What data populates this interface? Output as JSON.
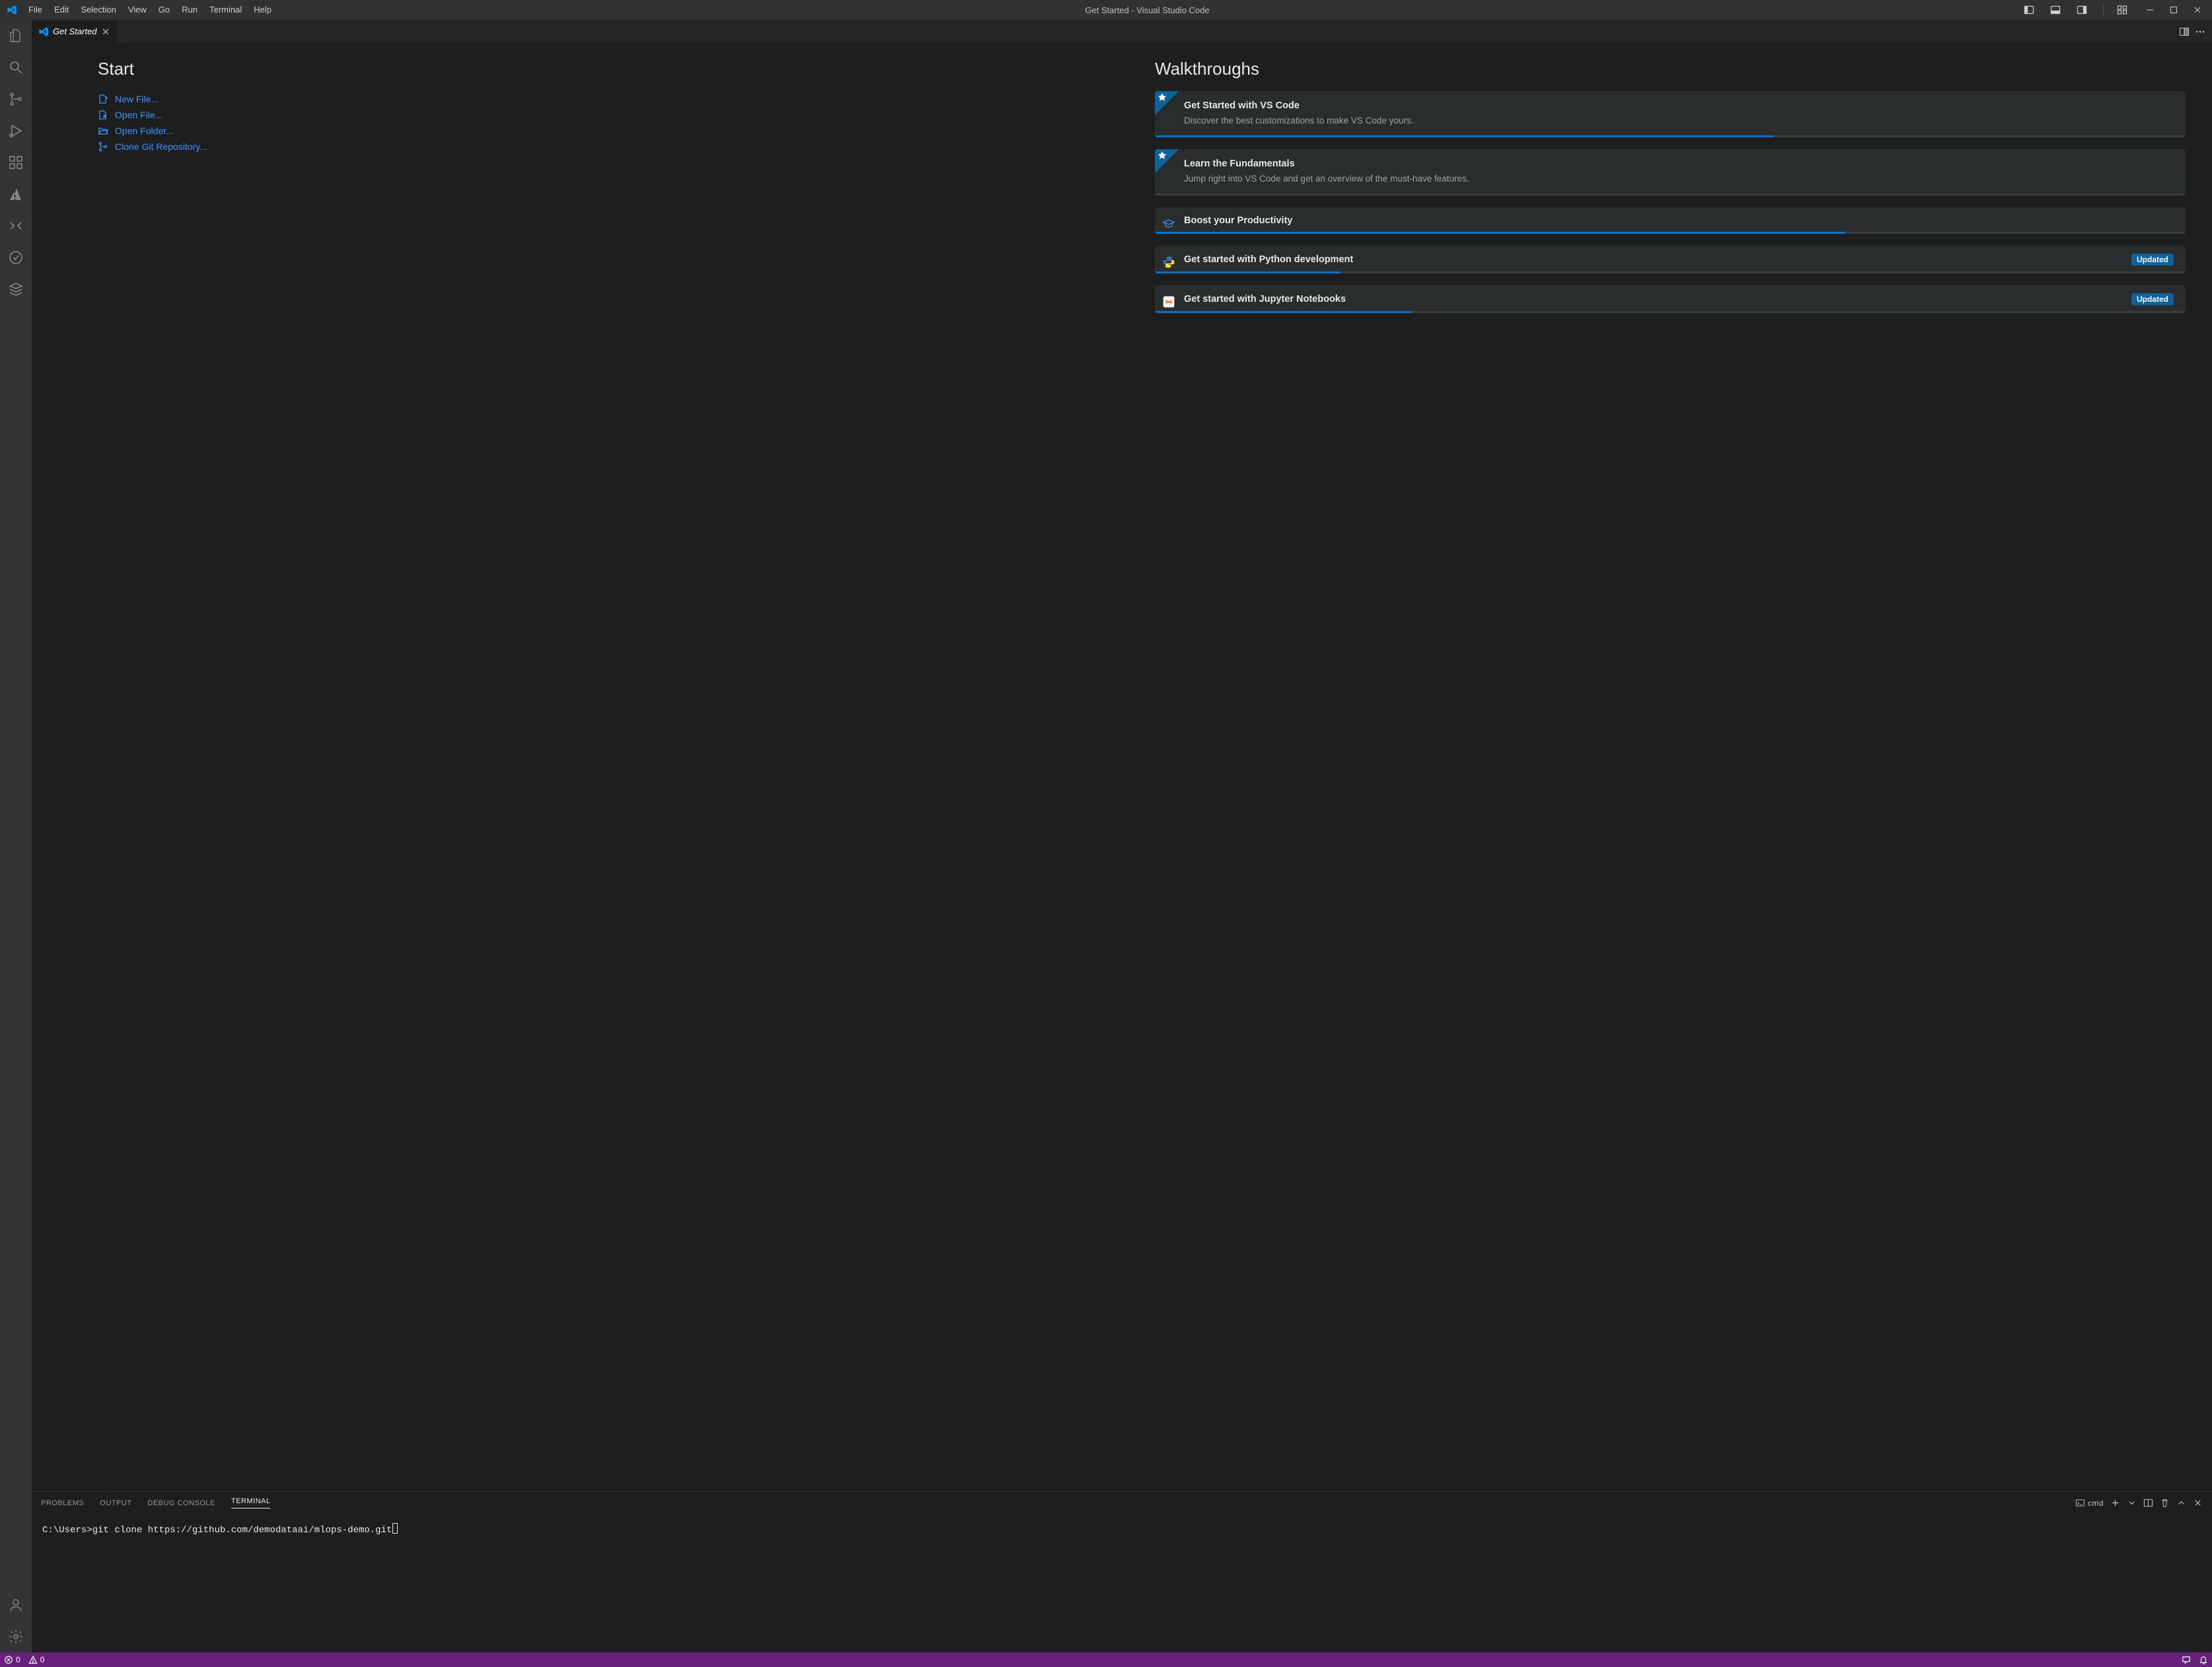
{
  "menubar": {
    "items": [
      "File",
      "Edit",
      "Selection",
      "View",
      "Go",
      "Run",
      "Terminal",
      "Help"
    ]
  },
  "titlebar": {
    "title": "Get Started - Visual Studio Code"
  },
  "tab": {
    "label": "Get Started"
  },
  "getStarted": {
    "startHeading": "Start",
    "startLinks": {
      "newFile": "New File...",
      "openFile": "Open File...",
      "openFolder": "Open Folder...",
      "cloneRepo": "Clone Git Repository..."
    },
    "walkthroughsHeading": "Walkthroughs",
    "walkthroughs": {
      "w0": {
        "title": "Get Started with VS Code",
        "desc": "Discover the best customizations to make VS Code yours."
      },
      "w1": {
        "title": "Learn the Fundamentals",
        "desc": "Jump right into VS Code and get an overview of the must-have features."
      },
      "w2": {
        "title": "Boost your Productivity"
      },
      "w3": {
        "title": "Get started with Python development",
        "badge": "Updated"
      },
      "w4": {
        "title": "Get started with Jupyter Notebooks",
        "badge": "Updated"
      }
    }
  },
  "panel": {
    "tabs": {
      "problems": "PROBLEMS",
      "output": "OUTPUT",
      "debugConsole": "DEBUG CONSOLE",
      "terminal": "TERMINAL"
    },
    "shell": "cmd",
    "terminalLine": "C:\\Users>git clone https://github.com/demodataai/mlops-demo.git"
  },
  "statusbar": {
    "errors": "0",
    "warnings": "0"
  }
}
